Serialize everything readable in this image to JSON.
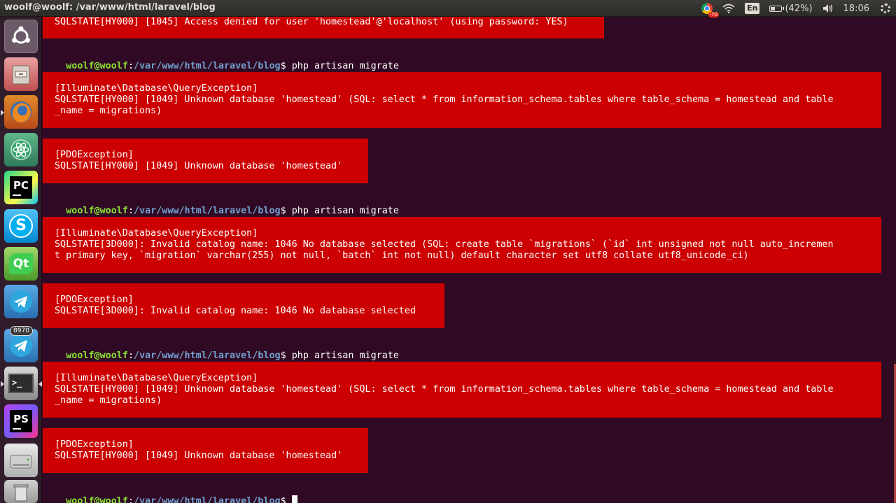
{
  "window": {
    "title": "woolf@woolf: /var/www/html/laravel/blog"
  },
  "tray": {
    "chrome_badge": "-70",
    "keyboard_layout": "En",
    "battery_text": "(42%)",
    "battery_level_percent": 42,
    "clock": "18:06"
  },
  "launcher": {
    "items": [
      {
        "name": "ubuntu-dash",
        "label": ""
      },
      {
        "name": "files",
        "label": ""
      },
      {
        "name": "firefox",
        "label": ""
      },
      {
        "name": "atom",
        "label": ""
      },
      {
        "name": "pycharm",
        "label": "PC"
      },
      {
        "name": "skype",
        "label": "S"
      },
      {
        "name": "qt-creator",
        "label": "Qt"
      },
      {
        "name": "telegram",
        "label": ""
      },
      {
        "name": "telegram-2",
        "label": "",
        "badge": "8970"
      },
      {
        "name": "terminal",
        "label": ">_"
      },
      {
        "name": "phpstorm",
        "label": "PS"
      },
      {
        "name": "disk",
        "label": ""
      },
      {
        "name": "trash",
        "label": ""
      }
    ]
  },
  "terminal": {
    "prompt": {
      "user_host": "woolf@woolf",
      "sep": ":",
      "path": "/var/www/html/laravel/blog",
      "dollar": "$ ",
      "command": "php artisan migrate"
    },
    "err0": {
      "lines": [
        "SQLSTATE[HY000] [1045] Access denied for user 'homestead'@'localhost' (using password: YES)"
      ]
    },
    "err1": {
      "lines": [
        "",
        "[Illuminate\\Database\\QueryException]",
        "SQLSTATE[HY000] [1049] Unknown database 'homestead' (SQL: select * from information_schema.tables where table_schema = homestead and table",
        "_name = migrations)",
        ""
      ]
    },
    "err2": {
      "lines": [
        "",
        "[PDOException]",
        "SQLSTATE[HY000] [1049] Unknown database 'homestead'",
        ""
      ]
    },
    "err3": {
      "lines": [
        "",
        "[Illuminate\\Database\\QueryException]",
        "SQLSTATE[3D000]: Invalid catalog name: 1046 No database selected (SQL: create table `migrations` (`id` int unsigned not null auto_incremen",
        "t primary key, `migration` varchar(255) not null, `batch` int not null) default character set utf8 collate utf8_unicode_ci)",
        ""
      ]
    },
    "err4": {
      "lines": [
        "",
        "[PDOException]",
        "SQLSTATE[3D000]: Invalid catalog name: 1046 No database selected",
        ""
      ]
    },
    "err5": {
      "lines": [
        "",
        "[Illuminate\\Database\\QueryException]",
        "SQLSTATE[HY000] [1049] Unknown database 'homestead' (SQL: select * from information_schema.tables where table_schema = homestead and table",
        "_name = migrations)",
        ""
      ]
    },
    "err6": {
      "lines": [
        "",
        "[PDOException]",
        "SQLSTATE[HY000] [1049] Unknown database 'homestead'",
        ""
      ]
    }
  },
  "colors": {
    "background": "#300a24",
    "error_box": "#cc0000",
    "prompt_user": "#8ae234",
    "prompt_path": "#729fcf"
  }
}
